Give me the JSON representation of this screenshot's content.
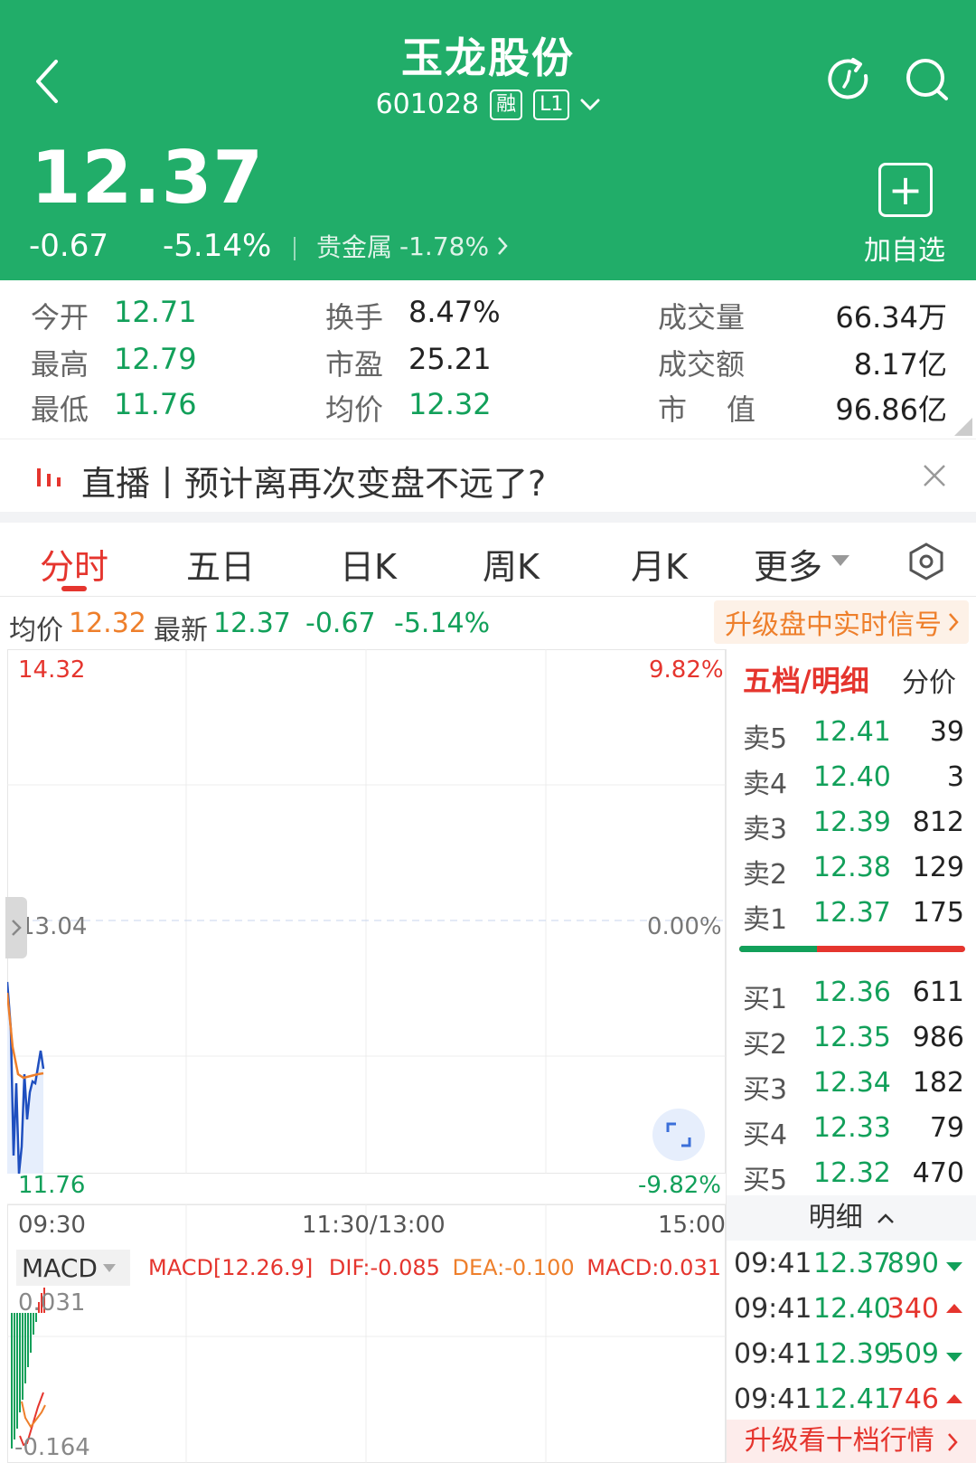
{
  "header": {
    "title": "玉龙股份",
    "code": "601028",
    "tag_margin": "融",
    "tag_level": "L1",
    "price": "12.37",
    "change": "-0.67",
    "change_pct": "-5.14%",
    "sector_name": "贵金属",
    "sector_pct": "-1.78%",
    "add_label": "加自选",
    "icons": [
      "back-chevron-icon",
      "refresh-icon",
      "search-icon",
      "plus-icon"
    ]
  },
  "stats": {
    "open_label": "今开",
    "open": "12.71",
    "high_label": "最高",
    "high": "12.79",
    "low_label": "最低",
    "low": "11.76",
    "turnover_label": "换手",
    "turnover": "8.47%",
    "pe_label": "市盈",
    "pe": "25.21",
    "avg_label": "均价",
    "avg": "12.32",
    "volume_label": "成交量",
    "volume": "66.34万",
    "amount_label": "成交额",
    "amount": "8.17亿",
    "mcap_label1": "市",
    "mcap_label2": "值",
    "mcap": "96.86亿"
  },
  "live": {
    "text": "直播丨预计离再次变盘不远了?"
  },
  "tabs": [
    "分时",
    "五日",
    "日K",
    "周K",
    "月K",
    "更多"
  ],
  "infoline": {
    "avg_label": "均价",
    "avg": "12.32",
    "latest_label": "最新",
    "latest": "12.37",
    "change": "-0.67",
    "pct": "-5.14%",
    "promo": "升级盘中实时信号"
  },
  "chart": {
    "y_top": "14.32",
    "y_mid": "13.04",
    "y_bot": "11.76",
    "pct_top": "9.82%",
    "pct_mid": "0.00%",
    "pct_bot": "-9.82%",
    "time_start": "09:30",
    "time_mid": "11:30/13:00",
    "time_end": "15:00"
  },
  "macd": {
    "selector": "MACD",
    "params": "MACD[12.26.9]",
    "dif": "DIF:-0.085",
    "dea": "DEA:-0.100",
    "macd": "MACD:0.031",
    "top": "0.031",
    "bottom": "-0.164"
  },
  "orderbook": {
    "title": "五档/明细",
    "alt": "分价",
    "sell": [
      {
        "label": "卖5",
        "price": "12.41",
        "qty": "39"
      },
      {
        "label": "卖4",
        "price": "12.40",
        "qty": "3"
      },
      {
        "label": "卖3",
        "price": "12.39",
        "qty": "812"
      },
      {
        "label": "卖2",
        "price": "12.38",
        "qty": "129"
      },
      {
        "label": "卖1",
        "price": "12.37",
        "qty": "175"
      }
    ],
    "buy": [
      {
        "label": "买1",
        "price": "12.36",
        "qty": "611"
      },
      {
        "label": "买2",
        "price": "12.35",
        "qty": "986"
      },
      {
        "label": "买3",
        "price": "12.34",
        "qty": "182"
      },
      {
        "label": "买4",
        "price": "12.33",
        "qty": "79"
      },
      {
        "label": "买5",
        "price": "12.32",
        "qty": "470"
      }
    ]
  },
  "trades": {
    "title": "明细",
    "rows": [
      {
        "time": "09:41",
        "price": "12.37",
        "vol": "890",
        "dir": "down"
      },
      {
        "time": "09:41",
        "price": "12.40",
        "vol": "340",
        "dir": "up"
      },
      {
        "time": "09:41",
        "price": "12.39",
        "vol": "509",
        "dir": "down"
      },
      {
        "time": "09:41",
        "price": "12.41",
        "vol": "746",
        "dir": "up"
      }
    ],
    "upgrade": "升级看十档行情"
  },
  "colors": {
    "brand": "#21ad69",
    "up": "#e5352e",
    "down": "#12a05a",
    "accent": "#ee7f2b"
  }
}
